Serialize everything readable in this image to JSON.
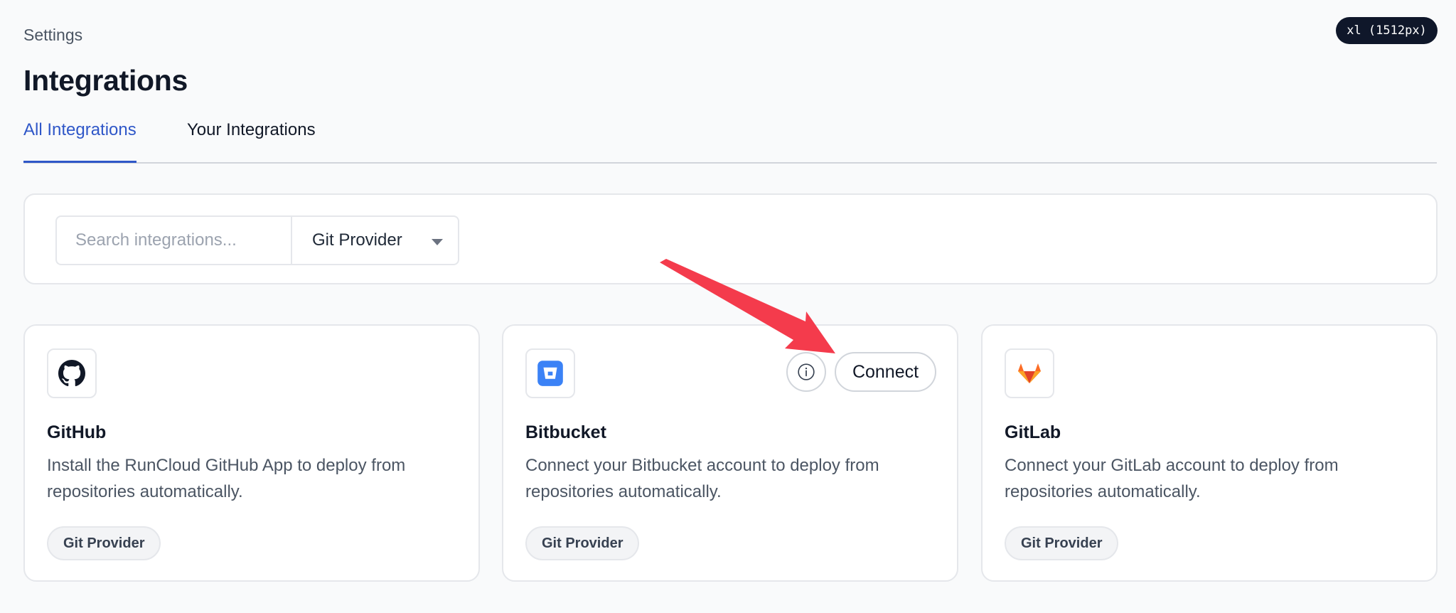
{
  "header": {
    "breadcrumb": "Settings",
    "title": "Integrations",
    "breakpoint_badge": "xl (1512px)"
  },
  "tabs": [
    {
      "label": "All Integrations",
      "active": true
    },
    {
      "label": "Your Integrations",
      "active": false
    }
  ],
  "filters": {
    "search_placeholder": "Search integrations...",
    "search_value": "",
    "category_selected": "Git Provider"
  },
  "integrations": [
    {
      "name": "GitHub",
      "description": "Install the RunCloud GitHub App to deploy from repositories automatically.",
      "tag": "Git Provider",
      "icon": "github-icon"
    },
    {
      "name": "Bitbucket",
      "description": "Connect your Bitbucket account to deploy from repositories automatically.",
      "tag": "Git Provider",
      "icon": "bitbucket-icon",
      "connect_label": "Connect"
    },
    {
      "name": "GitLab",
      "description": "Connect your GitLab account to deploy from repositories automatically.",
      "tag": "Git Provider",
      "icon": "gitlab-icon"
    }
  ],
  "colors": {
    "accent": "#2f57c8",
    "annotation_arrow": "#f43b4c",
    "badge_bg": "#0f172a"
  }
}
